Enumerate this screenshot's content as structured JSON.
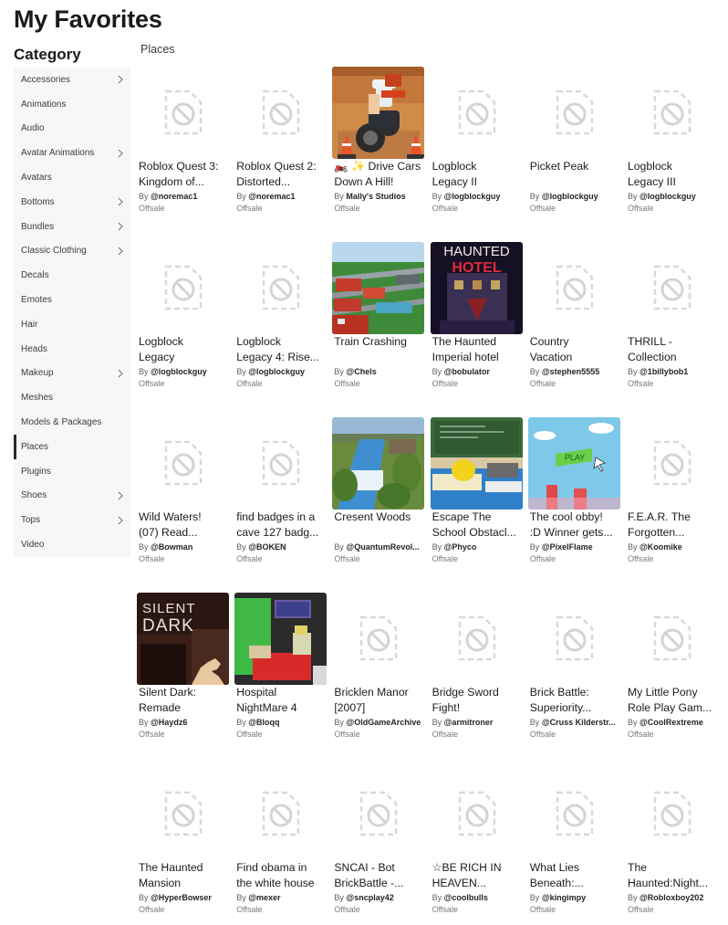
{
  "page": {
    "title": "My Favorites"
  },
  "sidebar": {
    "title": "Category",
    "items": [
      {
        "label": "Accessories",
        "chevron": true,
        "active": false
      },
      {
        "label": "Animations",
        "chevron": false,
        "active": false
      },
      {
        "label": "Audio",
        "chevron": false,
        "active": false
      },
      {
        "label": "Avatar Animations",
        "chevron": true,
        "active": false
      },
      {
        "label": "Avatars",
        "chevron": false,
        "active": false
      },
      {
        "label": "Bottoms",
        "chevron": true,
        "active": false
      },
      {
        "label": "Bundles",
        "chevron": true,
        "active": false
      },
      {
        "label": "Classic Clothing",
        "chevron": true,
        "active": false
      },
      {
        "label": "Decals",
        "chevron": false,
        "active": false
      },
      {
        "label": "Emotes",
        "chevron": false,
        "active": false
      },
      {
        "label": "Hair",
        "chevron": false,
        "active": false
      },
      {
        "label": "Heads",
        "chevron": false,
        "active": false
      },
      {
        "label": "Makeup",
        "chevron": true,
        "active": false
      },
      {
        "label": "Meshes",
        "chevron": false,
        "active": false
      },
      {
        "label": "Models & Packages",
        "chevron": false,
        "active": false
      },
      {
        "label": "Places",
        "chevron": false,
        "active": true
      },
      {
        "label": "Plugins",
        "chevron": false,
        "active": false
      },
      {
        "label": "Shoes",
        "chevron": true,
        "active": false
      },
      {
        "label": "Tops",
        "chevron": true,
        "active": false
      },
      {
        "label": "Video",
        "chevron": false,
        "active": false
      }
    ]
  },
  "section": {
    "label": "Places"
  },
  "by_prefix": "By",
  "items": [
    {
      "title": [
        "Roblox Quest 3:",
        "Kingdom of..."
      ],
      "creator": "@noremac1",
      "price": "Offsale",
      "thumb": "placeholder"
    },
    {
      "title": [
        "Roblox Quest 2:",
        "Distorted..."
      ],
      "creator": "@noremac1",
      "price": "Offsale",
      "thumb": "placeholder"
    },
    {
      "title": [
        "🏍️ ✨ Drive Cars",
        "Down A Hill!"
      ],
      "creator": "Mally's Studios",
      "price": "Offsale",
      "thumb": "drive-cars"
    },
    {
      "title": [
        "Logblock",
        "Legacy II"
      ],
      "creator": "@logblockguy",
      "price": "Offsale",
      "thumb": "placeholder"
    },
    {
      "title": [
        "Picket Peak",
        ""
      ],
      "creator": "@logblockguy",
      "price": "Offsale",
      "thumb": "placeholder"
    },
    {
      "title": [
        "Logblock",
        "Legacy III"
      ],
      "creator": "@logblockguy",
      "price": "Offsale",
      "thumb": "placeholder"
    },
    {
      "title": [
        "Logblock",
        "Legacy"
      ],
      "creator": "@logblockguy",
      "price": "Offsale",
      "thumb": "placeholder"
    },
    {
      "title": [
        "Logblock",
        "Legacy 4: Rise..."
      ],
      "creator": "@logblockguy",
      "price": "Offsale",
      "thumb": "placeholder"
    },
    {
      "title": [
        "Train Crashing",
        ""
      ],
      "creator": "@Chels",
      "price": "Offsale",
      "thumb": "train"
    },
    {
      "title": [
        "The Haunted",
        "Imperial hotel"
      ],
      "creator": "@bobulator",
      "price": "Offsale",
      "thumb": "haunted-hotel"
    },
    {
      "title": [
        "Country",
        "Vacation"
      ],
      "creator": "@stephen5555",
      "price": "Offsale",
      "thumb": "placeholder"
    },
    {
      "title": [
        "THRILL -",
        "Collection"
      ],
      "creator": "@1billybob1",
      "price": "Offsale",
      "thumb": "placeholder"
    },
    {
      "title": [
        "Wild Waters!",
        "(07) Read..."
      ],
      "creator": "@Bowman",
      "price": "Offsale",
      "thumb": "placeholder"
    },
    {
      "title": [
        "find badges in a",
        "cave 127 badg..."
      ],
      "creator": "@BOKEN",
      "price": "Offsale",
      "thumb": "placeholder"
    },
    {
      "title": [
        "Cresent Woods",
        ""
      ],
      "creator": "@QuantumRevol...",
      "price": "Offsale",
      "thumb": "cresent-woods"
    },
    {
      "title": [
        "Escape The",
        "School Obstacl..."
      ],
      "creator": "@Phyco",
      "price": "Offsale",
      "thumb": "escape-school"
    },
    {
      "title": [
        "The cool obby!",
        ":D Winner gets..."
      ],
      "creator": "@PixelFlame",
      "price": "Offsale",
      "thumb": "cool-obby"
    },
    {
      "title": [
        "F.E.A.R. The",
        "Forgotten..."
      ],
      "creator": "@Koomike",
      "price": "Offsale",
      "thumb": "placeholder"
    },
    {
      "title": [
        "Silent Dark:",
        "Remade"
      ],
      "creator": "@Haydz6",
      "price": "Offsale",
      "thumb": "silent-dark"
    },
    {
      "title": [
        "Hospital",
        "NightMare 4"
      ],
      "creator": "@Bloqq",
      "price": "Offsale",
      "thumb": "hospital"
    },
    {
      "title": [
        "Bricklen Manor",
        "[2007]"
      ],
      "creator": "@OldGameArchive",
      "price": "Offsale",
      "thumb": "placeholder"
    },
    {
      "title": [
        "Bridge Sword",
        "Fight!"
      ],
      "creator": "@armitroner",
      "price": "Offsale",
      "thumb": "placeholder"
    },
    {
      "title": [
        "Brick Battle:",
        "Superiority..."
      ],
      "creator": "@Cruss Kilderstr...",
      "price": "Offsale",
      "thumb": "placeholder"
    },
    {
      "title": [
        "My Little Pony",
        "Role Play Gam..."
      ],
      "creator": "@CoolRextreme",
      "price": "Offsale",
      "thumb": "placeholder"
    },
    {
      "title": [
        "The Haunted",
        "Mansion"
      ],
      "creator": "@HyperBowser",
      "price": "Offsale",
      "thumb": "placeholder"
    },
    {
      "title": [
        "Find obama in",
        "the white house"
      ],
      "creator": "@mexer",
      "price": "Offsale",
      "thumb": "placeholder"
    },
    {
      "title": [
        "SNCAI - Bot",
        "BrickBattle -..."
      ],
      "creator": "@sncplay42",
      "price": "Offsale",
      "thumb": "placeholder"
    },
    {
      "title": [
        "☆BE RICH IN",
        "HEAVEN..."
      ],
      "creator": "@coolbulls",
      "price": "Offsale",
      "thumb": "placeholder"
    },
    {
      "title": [
        "What Lies",
        "Beneath:..."
      ],
      "creator": "@kingimpy",
      "price": "Offsale",
      "thumb": "placeholder"
    },
    {
      "title": [
        "The",
        "Haunted:Night..."
      ],
      "creator": "@Robloxboy202",
      "price": "Offsale",
      "thumb": "placeholder"
    }
  ],
  "thumb_texts": {
    "haunted_hotel": [
      "HAUNTED",
      "HOTEL"
    ],
    "silent_dark": [
      "SILENT",
      "DARK"
    ],
    "cool_obby": "PLAY"
  },
  "icons": {
    "placeholder": "blocked-file-icon",
    "chevron": "chevron-right-icon"
  },
  "colors": {
    "active_indicator": "#2a2b2d",
    "sidebar_bg": "#f7f7f8"
  }
}
